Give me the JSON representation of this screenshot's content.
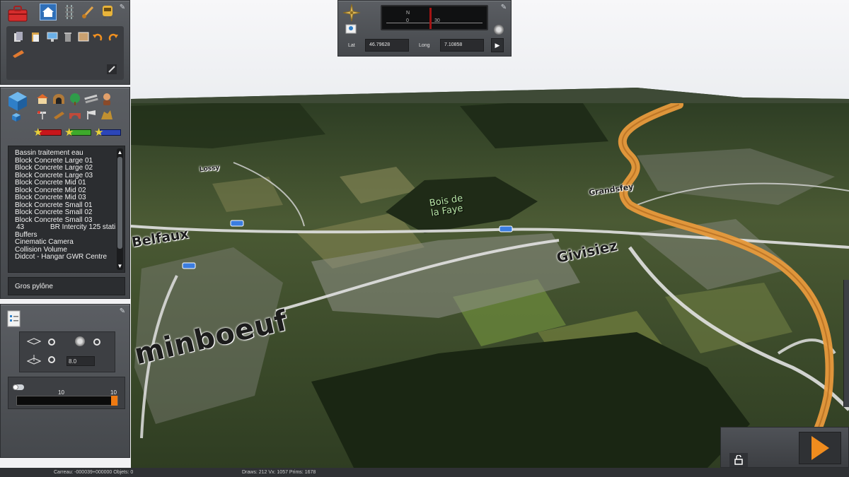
{
  "map": {
    "places": {
      "belfaux": "Belfaux",
      "givisiez": "Givisiez",
      "corminboeuf": "minboeuf",
      "bois_line1": "Bois de",
      "bois_line2": "la Faye",
      "grandsfey": "Grandsfey",
      "lossy": "Lossy"
    },
    "colors": {
      "railway": "#e89a3c",
      "road": "#e2e2e2",
      "terrain_dark": "#24321c",
      "terrain_light": "#5d6b3e"
    }
  },
  "compass": {
    "dial_north": "N",
    "dial_zero": "0",
    "dial_thirty": "30",
    "lat_label": "Lat",
    "lat_value": "46.79628",
    "long_label": "Long",
    "long_value": "7.10858",
    "go_symbol": "▶"
  },
  "toolbar": {
    "top_tools": [
      "toolbox-icon",
      "home-icon",
      "track-icon",
      "brush-icon",
      "train-icon"
    ],
    "edit_tools": [
      "copy-icon",
      "paste-icon",
      "screen-icon",
      "trash-icon",
      "frame-icon",
      "undo-icon",
      "redo-icon"
    ]
  },
  "assets": {
    "categories": [
      "building-icon",
      "tunnel-icon",
      "tree-icon",
      "rail-icon",
      "person-icon",
      "signal-icon",
      "crossing-icon",
      "bridge-icon",
      "light-icon",
      "rock-icon"
    ],
    "items": [
      "Bassin traitement eau",
      "Block Concrete Large 01",
      "Block Concrete Large 02",
      "Block Concrete Large 03",
      "Block Concrete Mid 01",
      "Block Concrete Mid 02",
      "Block Concrete Mid 03",
      "Block Concrete Small 01",
      "Block Concrete Small 02",
      "Block Concrete Small 03"
    ],
    "sub_item": {
      "number": "43",
      "label": "BR Intercity 125 stati"
    },
    "items_after": [
      "Buffers",
      "Cinematic Camera",
      "Collision Volume",
      "Didcot - Hangar GWR Centre"
    ],
    "selected": "Gros pylône",
    "filters": [
      {
        "color": "#c8161b"
      },
      {
        "color": "#3eaa2c"
      },
      {
        "color": "#2c46b8"
      }
    ]
  },
  "brush": {
    "size_value": "8.0",
    "slider_min_label": "10",
    "slider_max_label": "10",
    "slider_fraction": 1.0,
    "slider_color": "#ef7a12"
  },
  "status": {
    "tile": "Carreau: -000039+000000  Objets: 0",
    "render": "Draws: 212 Vx: 1057 Prims: 1678"
  }
}
